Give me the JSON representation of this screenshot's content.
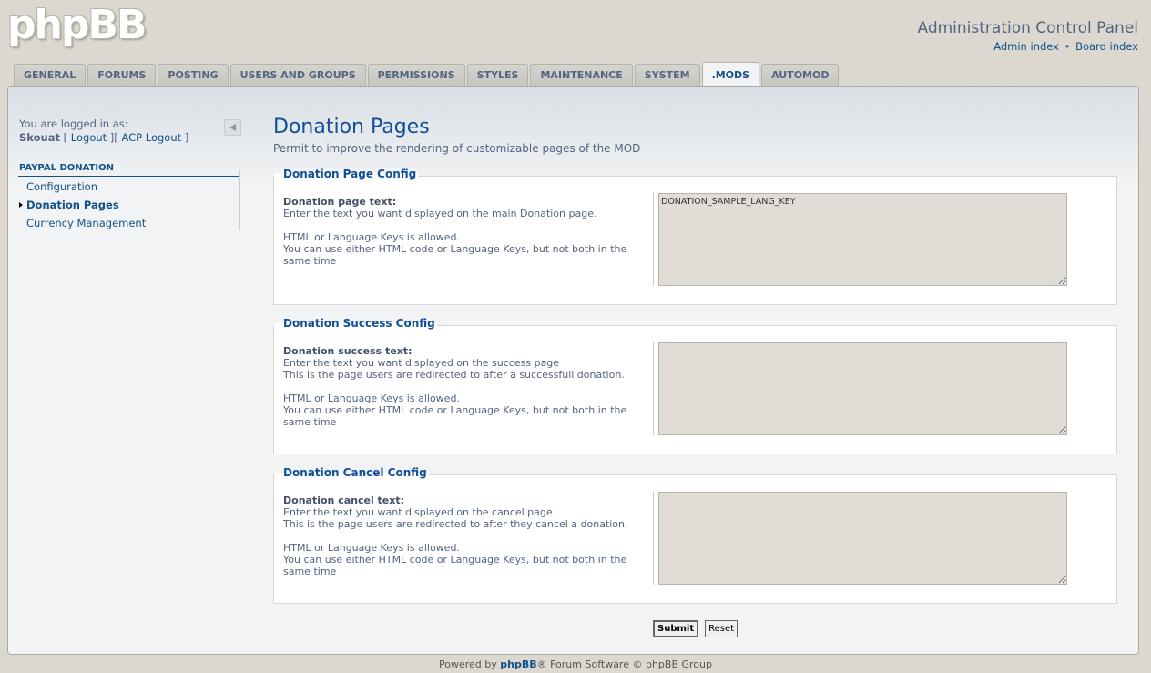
{
  "header": {
    "logo": "phpBB",
    "title": "Administration Control Panel",
    "links": [
      "Admin index",
      "Board index"
    ],
    "separator": "•"
  },
  "tabs": [
    {
      "label": "GENERAL"
    },
    {
      "label": "FORUMS"
    },
    {
      "label": "POSTING"
    },
    {
      "label": "USERS AND GROUPS"
    },
    {
      "label": "PERMISSIONS"
    },
    {
      "label": "STYLES"
    },
    {
      "label": "MAINTENANCE"
    },
    {
      "label": "SYSTEM"
    },
    {
      "label": ".MODS",
      "active": true
    },
    {
      "label": "AUTOMOD"
    }
  ],
  "sidebar": {
    "logged_in_as": "You are logged in as:",
    "username": "Skouat",
    "logout": "Logout",
    "acp_logout": "ACP Logout",
    "section": "PAYPAL DONATION",
    "items": [
      {
        "label": "Configuration"
      },
      {
        "label": "Donation Pages",
        "active": true
      },
      {
        "label": "Currency Management"
      }
    ]
  },
  "main": {
    "title": "Donation Pages",
    "description": "Permit to improve the rendering of customizable pages of the MOD",
    "fieldsets": [
      {
        "legend": "Donation Page Config",
        "label": "Donation page text:",
        "lines": [
          "Enter the text you want displayed on the main Donation page.",
          "",
          "HTML or Language Keys is allowed.",
          "You can use either HTML code or Language Keys, but not both in the same time"
        ],
        "value": "DONATION_SAMPLE_LANG_KEY"
      },
      {
        "legend": "Donation Success Config",
        "label": "Donation success text:",
        "lines": [
          "Enter the text you want displayed on the success page",
          "This is the page users are redirected to after a successfull donation.",
          "",
          "HTML or Language Keys is allowed.",
          "You can use either HTML code or Language Keys, but not both in the same time"
        ],
        "value": ""
      },
      {
        "legend": "Donation Cancel Config",
        "label": "Donation cancel text:",
        "lines": [
          "Enter the text you want displayed on the cancel page",
          "This is the page users are redirected to after they cancel a donation.",
          "",
          "HTML or Language Keys is allowed.",
          "You can use either HTML code or Language Keys, but not both in the same time"
        ],
        "value": ""
      }
    ],
    "submit_label": "Submit",
    "reset_label": "Reset"
  },
  "footer": {
    "powered_by": "Powered by",
    "link": "phpBB",
    "rest": "® Forum Software © phpBB Group"
  }
}
